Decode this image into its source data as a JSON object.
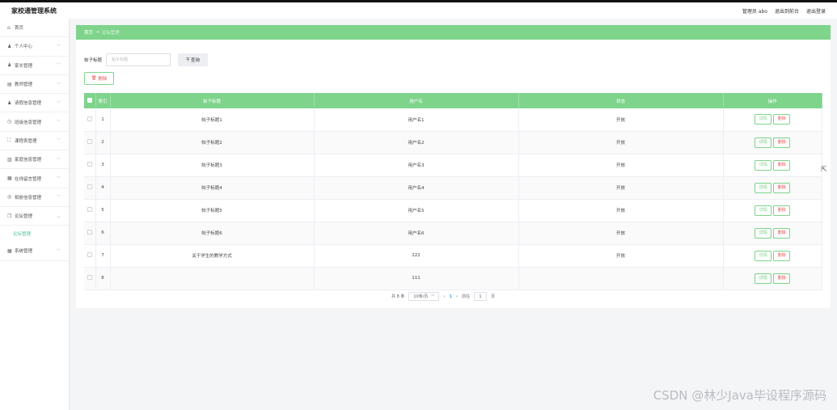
{
  "app": {
    "title": "家校通管理系统",
    "top_links": [
      "管理员 abo",
      "退出到前台",
      "退出登录"
    ]
  },
  "sidebar": {
    "items": [
      {
        "icon": "home-icon",
        "glyph": "⌂",
        "label": "首页",
        "chev": ""
      },
      {
        "icon": "user-icon",
        "glyph": "♟",
        "label": "个人中心",
        "chev": "﹀"
      },
      {
        "icon": "user-icon",
        "glyph": "♟",
        "label": "家长管理",
        "chev": "﹀"
      },
      {
        "icon": "bank-icon",
        "glyph": "▤",
        "label": "教师管理",
        "chev": "﹀"
      },
      {
        "icon": "user-icon",
        "glyph": "♟",
        "label": "请假信息管理",
        "chev": "﹀"
      },
      {
        "icon": "clock-icon",
        "glyph": "◷",
        "label": "班级信息管理",
        "chev": "﹀"
      },
      {
        "icon": "frame-icon",
        "glyph": "⛶",
        "label": "课程表管理",
        "chev": "﹀"
      },
      {
        "icon": "chart-icon",
        "glyph": "▥",
        "label": "家庭信息管理",
        "chev": "﹀"
      },
      {
        "icon": "grid-icon",
        "glyph": "▦",
        "label": "在线留言管理",
        "chev": "﹀"
      },
      {
        "icon": "circle-icon",
        "glyph": "◎",
        "label": "相册信息管理",
        "chev": "﹀"
      },
      {
        "icon": "copy-icon",
        "glyph": "❐",
        "label": "论坛管理",
        "chev": "︿"
      }
    ],
    "sub_item": "论坛管理",
    "last_item": {
      "icon": "grid-icon",
      "glyph": "▦",
      "label": "系统管理",
      "chev": "﹀"
    }
  },
  "breadcrumb": {
    "home": "首页",
    "sep": "→",
    "current": "论坛管理"
  },
  "search": {
    "label": "帖子标题",
    "placeholder": "帖子标题",
    "button": "查询"
  },
  "delete_button": "删除",
  "table": {
    "headers": [
      "索引",
      "帖子标题",
      "用户名",
      "状态",
      "操作"
    ],
    "rows": [
      {
        "index": "1",
        "title": "帖子标题1",
        "user": "用户名1",
        "status": "开放"
      },
      {
        "index": "2",
        "title": "帖子标题2",
        "user": "用户名2",
        "status": "开放"
      },
      {
        "index": "3",
        "title": "帖子标题3",
        "user": "用户名3",
        "status": "开放"
      },
      {
        "index": "4",
        "title": "帖子标题4",
        "user": "用户名4",
        "status": "开放"
      },
      {
        "index": "5",
        "title": "帖子标题5",
        "user": "用户名5",
        "status": "开放"
      },
      {
        "index": "6",
        "title": "帖子标题6",
        "user": "用户名6",
        "status": "开放"
      },
      {
        "index": "7",
        "title": "关于学生的教学方式",
        "user": "222",
        "status": "开放"
      },
      {
        "index": "8",
        "title": "",
        "user": "111",
        "status": ""
      }
    ],
    "action_detail": "详情",
    "action_delete": "删除"
  },
  "pager": {
    "total": "共 8 条",
    "size": "10条/页",
    "prev": "‹",
    "page": "1",
    "next": "›",
    "goto": "前往",
    "goto_page": "1",
    "unit": "页"
  },
  "watermark": "CSDN @林少Java毕设程序源码"
}
